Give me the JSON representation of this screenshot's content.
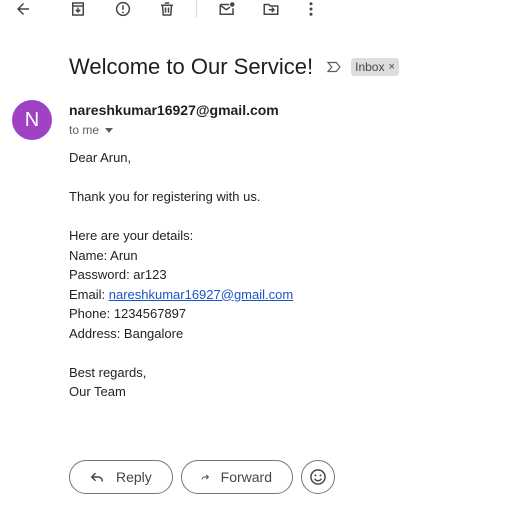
{
  "toolbar": {
    "icons": [
      "back-arrow-icon",
      "archive-icon",
      "report-spam-icon",
      "delete-icon",
      "mark-unread-icon",
      "move-to-icon",
      "more-options-icon"
    ]
  },
  "subject": "Welcome to Our Service!",
  "label_chip": {
    "text": "Inbox",
    "close": "×"
  },
  "sender": {
    "avatar_letter": "N",
    "avatar_color": "#a142c4",
    "email": "nareshkumar16927@gmail.com",
    "recipient": "to me"
  },
  "message": {
    "greeting": "Dear Arun,",
    "intro": "Thank you for registering with us.",
    "details_heading": "Here are your details:",
    "name_line": "Name: Arun",
    "password_line": "Password: ar123",
    "email_label": "Email: ",
    "email_link": "nareshkumar16927@gmail.com",
    "phone_line": "Phone: 1234567897",
    "address_line": "Address: Bangalore",
    "closing": "Best regards,",
    "signature": "Our Team"
  },
  "actions": {
    "reply_label": "Reply",
    "forward_label": "Forward"
  },
  "colors": {
    "link": "#1a55c7",
    "chip_bg": "#dddddd",
    "text": "#1f1f1f"
  }
}
